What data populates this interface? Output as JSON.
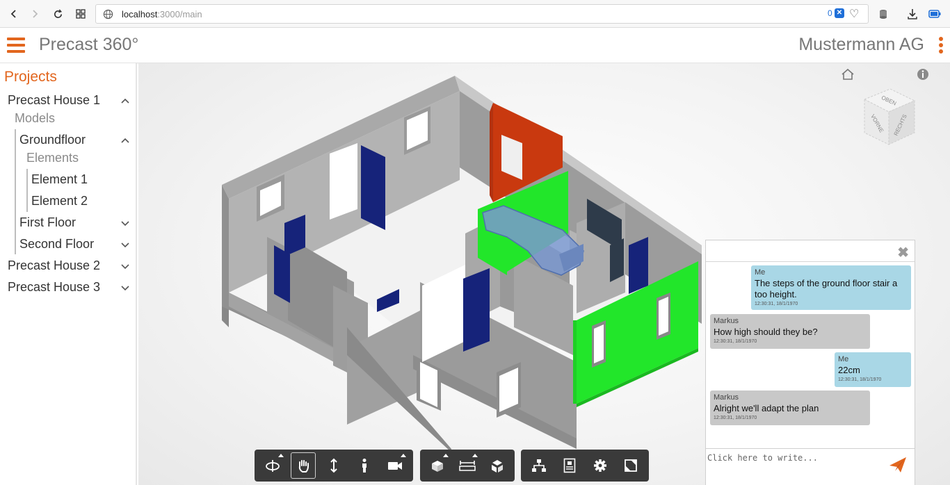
{
  "browser": {
    "url_host": "localhost",
    "url_rest": ":3000/main",
    "blocked_count": "0"
  },
  "header": {
    "title": "Precast 360°",
    "company": "Mustermann AG"
  },
  "sidebar": {
    "title": "Projects",
    "house1": "Precast House 1",
    "models": "Models",
    "groundfloor": "Groundfloor",
    "elements": "Elements",
    "element1": "Element 1",
    "element2": "Element 2",
    "firstfloor": "First Floor",
    "secondfloor": "Second Floor",
    "house2": "Precast House 2",
    "house3": "Precast House 3"
  },
  "viewcube": {
    "top": "OBEN",
    "front": "VORNE",
    "right": "RECHTS"
  },
  "chat": {
    "messages": [
      {
        "author": "Me",
        "text": "The steps of the ground floor stair a too height.",
        "time": "12:30:31, 18/1/1970"
      },
      {
        "author": "Markus",
        "text": "How high should they be?",
        "time": "12:30:31, 18/1/1970"
      },
      {
        "author": "Me",
        "text": "22cm",
        "time": "12:30:31, 18/1/1970"
      },
      {
        "author": "Markus",
        "text": "Alright we'll adapt the plan",
        "time": "12:30:31, 18/1/1970"
      }
    ],
    "placeholder": "Click here to write..."
  },
  "toolbar": {
    "navigation": [
      "orbit-icon",
      "pan-icon",
      "zoom-icon",
      "walk-icon",
      "camera-icon"
    ],
    "modeling": [
      "section-icon",
      "measure-icon",
      "explode-icon"
    ],
    "settings": [
      "structure-icon",
      "properties-icon",
      "settings-icon",
      "fullscreen-icon"
    ]
  },
  "colors": {
    "accent": "#e2661e",
    "highlight_green": "#22e62a",
    "highlight_red": "#c9390f",
    "door_blue": "#16237a",
    "chat_me": "#a9d7e6",
    "chat_other": "#c8c8c8"
  }
}
